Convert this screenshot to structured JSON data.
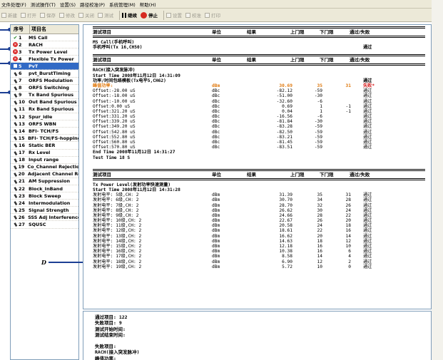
{
  "menu": [
    "文件处理(F)",
    "测试操作(T)",
    "设置(S)",
    "路径校准(P)",
    "系统管理(M)",
    "帮助(H)"
  ],
  "toolbar": [
    {
      "label": "新建",
      "enabled": false
    },
    {
      "label": "打开",
      "enabled": false
    },
    {
      "label": "保存",
      "enabled": false
    },
    {
      "label": "修改",
      "enabled": false
    },
    {
      "label": "关闭",
      "enabled": false
    },
    {
      "label": "测试",
      "enabled": false
    },
    {
      "label": "继续",
      "enabled": true
    },
    {
      "label": "停止",
      "enabled": true
    },
    {
      "label": "设置",
      "enabled": false
    },
    {
      "label": "校准",
      "enabled": false
    },
    {
      "label": "打印",
      "enabled": false
    }
  ],
  "testlist": {
    "col_no": "序号",
    "col_name": "项目名",
    "items": [
      {
        "no": "1",
        "name": "MS Call",
        "status": "ok"
      },
      {
        "no": "2",
        "name": "RACH",
        "status": "fail"
      },
      {
        "no": "3",
        "name": "Tx Power Level",
        "status": "fail"
      },
      {
        "no": "4",
        "name": "Flexible Tx Power",
        "status": "fail"
      },
      {
        "no": "5",
        "name": "PvT",
        "status": "selected"
      },
      {
        "no": "6",
        "name": "pvt_BurstTiming",
        "status": "pending"
      },
      {
        "no": "7",
        "name": "ORFS Modulation",
        "status": "pending"
      },
      {
        "no": "8",
        "name": "ORFS Switching",
        "status": "pending"
      },
      {
        "no": "9",
        "name": "Tx Band Spurious",
        "status": "pending"
      },
      {
        "no": "10",
        "name": "Out Band Spurious",
        "status": "pending"
      },
      {
        "no": "11",
        "name": "Rx Band Spurious",
        "status": "pending"
      },
      {
        "no": "12",
        "name": "Spur_idle",
        "status": "pending"
      },
      {
        "no": "13",
        "name": "ORFS WBN",
        "status": "pending"
      },
      {
        "no": "14",
        "name": "BFI- TCH/FS",
        "status": "pending"
      },
      {
        "no": "15",
        "name": "BFI- TCH/FS-hopping",
        "status": "pending"
      },
      {
        "no": "16",
        "name": "Static BER",
        "status": "pending"
      },
      {
        "no": "17",
        "name": "Rx Level",
        "status": "pending"
      },
      {
        "no": "18",
        "name": "Input range",
        "status": "pending"
      },
      {
        "no": "19",
        "name": "Co_Channel Rejection",
        "status": "pending"
      },
      {
        "no": "20",
        "name": "Adjacent Channel Re",
        "status": "pending"
      },
      {
        "no": "21",
        "name": "AM Suppression",
        "status": "pending"
      },
      {
        "no": "22",
        "name": "Block_InBand",
        "status": "pending"
      },
      {
        "no": "23",
        "name": "Block Sweep",
        "status": "pending"
      },
      {
        "no": "24",
        "name": "Intermodulation",
        "status": "pending"
      },
      {
        "no": "25",
        "name": "Signal Strength",
        "status": "pending"
      },
      {
        "no": "26",
        "name": "SSS Adj Interference",
        "status": "pending"
      },
      {
        "no": "27",
        "name": "SQUSC",
        "status": "pending"
      }
    ]
  },
  "annotation_label": "D",
  "report": {
    "headers": {
      "name": "测试项目",
      "unit": "单位",
      "result": "结果",
      "upper": "上门限",
      "lower": "下门限",
      "pass": "通过/失败"
    },
    "sec1": {
      "title1": "MS Call(手机呼叫)",
      "title2": "手机呼叫(Tx 16,CH50)",
      "pass": "通过"
    },
    "sec2": {
      "title": "RACH(接入突发脉冲)",
      "start": "Start Time 2008年11月12日  14:31:09",
      "sub": "功率/时间包络模板(Tx电平5,CH62)",
      "sub_pass": "通过",
      "peak": {
        "name": "峰值功率:",
        "unit": "dBm",
        "result": "30.69",
        "up": "35",
        "lo": "31",
        "pf": "失败*"
      },
      "rows": [
        {
          "name": "Offset:-28.00  uS",
          "unit": "dBc",
          "result": "-82.12",
          "up": "-59",
          "lo": "",
          "pf": "通过"
        },
        {
          "name": "Offset:-18.00  uS",
          "unit": "dBc",
          "result": "-51.00",
          "up": "-30",
          "lo": "",
          "pf": "通过"
        },
        {
          "name": "Offset:-10.00  uS",
          "unit": "dBc",
          "result": "-32.60",
          "up": "-6",
          "lo": "",
          "pf": "通过"
        },
        {
          "name": "Offset:0.00  uS",
          "unit": "dBc",
          "result": "0.69",
          "up": "1",
          "lo": "-1",
          "pf": "通过"
        },
        {
          "name": "Offset:321.20  uS",
          "unit": "dBc",
          "result": "0.04",
          "up": "1",
          "lo": "-1",
          "pf": "通过"
        },
        {
          "name": "Offset:331.20  uS",
          "unit": "dBc",
          "result": "-16.56",
          "up": "-6",
          "lo": "",
          "pf": "通过"
        },
        {
          "name": "Offset:339.20  uS",
          "unit": "dBc",
          "result": "-81.84",
          "up": "-30",
          "lo": "",
          "pf": "通过"
        },
        {
          "name": "Offset:349.20  uS",
          "unit": "dBc",
          "result": "-83.28",
          "up": "-59",
          "lo": "",
          "pf": "通过"
        },
        {
          "name": "Offset:542.80  uS",
          "unit": "dBc",
          "result": "-82.50",
          "up": "-59",
          "lo": "",
          "pf": "通过"
        },
        {
          "name": "Offset:552.80  uS",
          "unit": "dBc",
          "result": "-83.21",
          "up": "-59",
          "lo": "",
          "pf": "通过"
        },
        {
          "name": "Offset:560.80  uS",
          "unit": "dBc",
          "result": "-81.45",
          "up": "-59",
          "lo": "",
          "pf": "通过"
        },
        {
          "name": "Offset:570.80  uS",
          "unit": "dBc",
          "result": "-83.51",
          "up": "-59",
          "lo": "",
          "pf": "通过"
        }
      ],
      "end": "End Time 2008年11月12日  14:31:27",
      "test_time": "Test Time 18 S"
    },
    "sec3": {
      "title": "Tx Power Level(发射功率快速测量)",
      "start": "Start Time 2008年11月12日  14:31:28",
      "rows": [
        {
          "name": "发射电平:  5级,CH:  2",
          "unit": "dBm",
          "result": "31.39",
          "up": "35",
          "lo": "31",
          "pf": "通过"
        },
        {
          "name": "发射电平:  6级,CH:  2",
          "unit": "dBm",
          "result": "30.70",
          "up": "34",
          "lo": "28",
          "pf": "通过"
        },
        {
          "name": "发射电平:  7级,CH:  2",
          "unit": "dBm",
          "result": "28.70",
          "up": "32",
          "lo": "26",
          "pf": "通过"
        },
        {
          "name": "发射电平:  8级,CH:  2",
          "unit": "dBm",
          "result": "26.62",
          "up": "30",
          "lo": "24",
          "pf": "通过"
        },
        {
          "name": "发射电平:  9级,CH:  2",
          "unit": "dBm",
          "result": "24.66",
          "up": "28",
          "lo": "22",
          "pf": "通过"
        },
        {
          "name": "发射电平: 10级,CH:  2",
          "unit": "dBm",
          "result": "22.67",
          "up": "26",
          "lo": "20",
          "pf": "通过"
        },
        {
          "name": "发射电平: 11级,CH:  2",
          "unit": "dBm",
          "result": "20.58",
          "up": "24",
          "lo": "18",
          "pf": "通过"
        },
        {
          "name": "发射电平: 12级,CH:  2",
          "unit": "dBm",
          "result": "18.61",
          "up": "22",
          "lo": "16",
          "pf": "通过"
        },
        {
          "name": "发射电平: 13级,CH:  2",
          "unit": "dBm",
          "result": "16.62",
          "up": "20",
          "lo": "14",
          "pf": "通过"
        },
        {
          "name": "发射电平: 14级,CH:  2",
          "unit": "dBm",
          "result": "14.63",
          "up": "18",
          "lo": "12",
          "pf": "通过"
        },
        {
          "name": "发射电平: 15级,CH:  2",
          "unit": "dBm",
          "result": "12.18",
          "up": "16",
          "lo": "10",
          "pf": "通过"
        },
        {
          "name": "发射电平: 16级,CH:  2",
          "unit": "dBm",
          "result": "10.38",
          "up": "16",
          "lo": "6",
          "pf": "通过"
        },
        {
          "name": "发射电平: 17级,CH:  2",
          "unit": "dBm",
          "result": "8.58",
          "up": "14",
          "lo": "4",
          "pf": "通过"
        },
        {
          "name": "发射电平: 18级,CH:  2",
          "unit": "dBm",
          "result": "6.90",
          "up": "12",
          "lo": "2",
          "pf": "通过"
        },
        {
          "name": "发射电平: 19级,CH:  2",
          "unit": "dBm",
          "result": "5.72",
          "up": "10",
          "lo": "0",
          "pf": "通过"
        }
      ]
    }
  },
  "summary": {
    "lines": [
      "通过项目: 122",
      "失败项目: 9",
      "测试开始时间:",
      "测试结束时间:",
      "",
      "失败项目:",
      "RACH(接入突发脉冲)",
      "    峰值功率:"
    ]
  }
}
